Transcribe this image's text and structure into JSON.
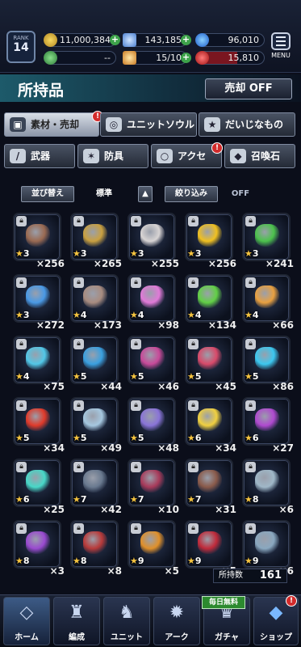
{
  "header": {
    "rank_label": "RANK",
    "rank_value": "14",
    "gil": "11,000,384",
    "lapis": "143,185",
    "energy": "96,010",
    "ticket": "--",
    "cap": "15/10",
    "red": "15,810",
    "menu_label": "MENU"
  },
  "title": "所持品",
  "sell_button": "売却 OFF",
  "tabs": [
    {
      "label": "素材・売却",
      "icon": "bag-icon",
      "badge": "!"
    },
    {
      "label": "ユニットソウル",
      "icon": "soul-icon"
    },
    {
      "label": "だいじなもの",
      "icon": "star-icon"
    },
    {
      "label": "武器",
      "icon": "sword-icon"
    },
    {
      "label": "防具",
      "icon": "armor-icon"
    },
    {
      "label": "アクセ",
      "icon": "ring-icon",
      "badge": "!"
    },
    {
      "label": "召喚石",
      "icon": "summon-stone-icon"
    }
  ],
  "filters": {
    "sort": "並び替え",
    "sort_mode": "標準",
    "narrow": "絞り込み",
    "narrow_state": "OFF"
  },
  "items": [
    {
      "rarity": "3",
      "count": "×256",
      "color": "#9a6a52"
    },
    {
      "rarity": "3",
      "count": "×265",
      "color": "#c9a040"
    },
    {
      "rarity": "3",
      "count": "×255",
      "color": "#d8d4d4"
    },
    {
      "rarity": "3",
      "count": "×256",
      "color": "#f0c020"
    },
    {
      "rarity": "3",
      "count": "×241",
      "color": "#4cc24c"
    },
    {
      "rarity": "3",
      "count": "×272",
      "color": "#4a9ae6"
    },
    {
      "rarity": "4",
      "count": "×173",
      "color": "#a88c80"
    },
    {
      "rarity": "4",
      "count": "×98",
      "color": "#e07ad8"
    },
    {
      "rarity": "4",
      "count": "×134",
      "color": "#62d046"
    },
    {
      "rarity": "4",
      "count": "×66",
      "color": "#e8a040"
    },
    {
      "rarity": "4",
      "count": "×75",
      "color": "#52c8e8"
    },
    {
      "rarity": "5",
      "count": "×44",
      "color": "#3aa0e0"
    },
    {
      "rarity": "5",
      "count": "×46",
      "color": "#c84a9a"
    },
    {
      "rarity": "5",
      "count": "×45",
      "color": "#d94a6a"
    },
    {
      "rarity": "5",
      "count": "×86",
      "color": "#3cc8f0"
    },
    {
      "rarity": "5",
      "count": "×34",
      "color": "#e03a2a"
    },
    {
      "rarity": "5",
      "count": "×49",
      "color": "#a6c8e0"
    },
    {
      "rarity": "5",
      "count": "×48",
      "color": "#8a74d8"
    },
    {
      "rarity": "6",
      "count": "×34",
      "color": "#f0d040"
    },
    {
      "rarity": "6",
      "count": "×27",
      "color": "#b04ad0"
    },
    {
      "rarity": "6",
      "count": "×25",
      "color": "#48d8c8"
    },
    {
      "rarity": "7",
      "count": "×42",
      "color": "#6a7a90"
    },
    {
      "rarity": "7",
      "count": "×10",
      "color": "#a83a5a"
    },
    {
      "rarity": "7",
      "count": "×31",
      "color": "#8a5a4a"
    },
    {
      "rarity": "8",
      "count": "×6",
      "color": "#a0b8c8"
    },
    {
      "rarity": "8",
      "count": "×3",
      "color": "#9a4ad0"
    },
    {
      "rarity": "8",
      "count": "×8",
      "color": "#b83a3a"
    },
    {
      "rarity": "9",
      "count": "×5",
      "color": "#e0902a"
    },
    {
      "rarity": "9",
      "count": "×5",
      "color": "#c02a3a"
    },
    {
      "rarity": "9",
      "count": "×6",
      "color": "#8aa8c0"
    }
  ],
  "owned": {
    "label": "所持数",
    "value": "161"
  },
  "nav": [
    {
      "label": "ホーム",
      "icon": "home-icon"
    },
    {
      "label": "編成",
      "icon": "party-icon"
    },
    {
      "label": "ユニット",
      "icon": "unit-icon"
    },
    {
      "label": "アーク",
      "icon": "ark-icon"
    },
    {
      "label": "ガチャ",
      "icon": "gacha-icon"
    },
    {
      "label": "ショップ",
      "icon": "shop-icon"
    }
  ],
  "daily_free": "毎日無料"
}
